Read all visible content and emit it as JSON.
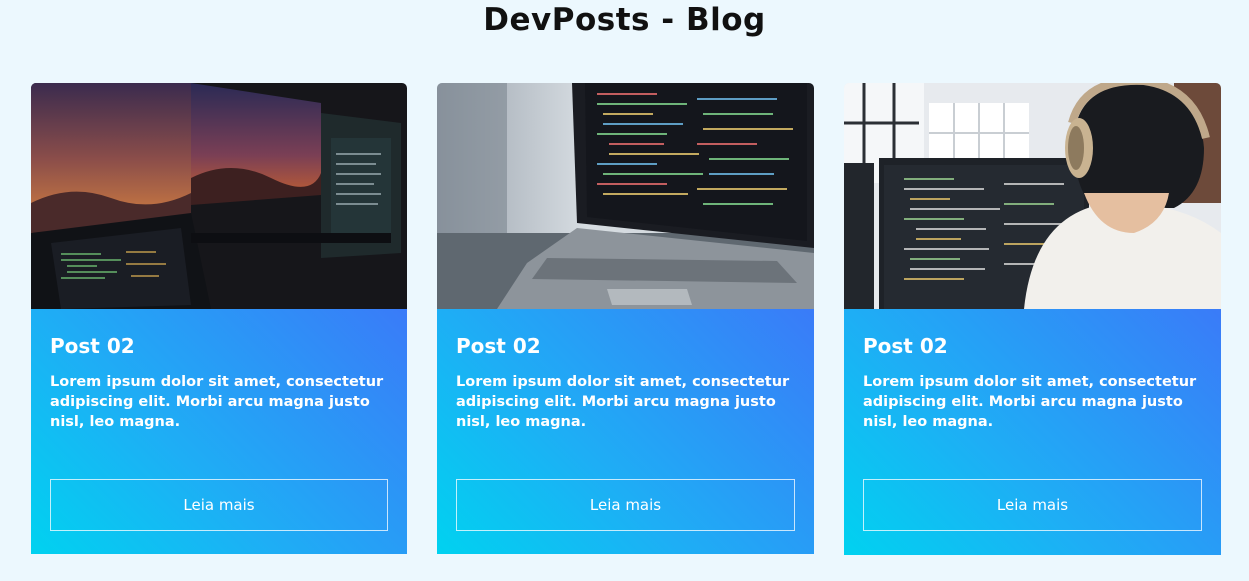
{
  "header": {
    "title": "DevPosts - Blog"
  },
  "posts": [
    {
      "title": "Post 02",
      "text": "Lorem ipsum dolor sit amet, consectetur adipiscing elit. Morbi arcu magna justo nisl, leo magna.",
      "button": "Leia mais"
    },
    {
      "title": "Post 02",
      "text": "Lorem ipsum dolor sit amet, consectetur adipiscing elit. Morbi arcu magna justo nisl, leo magna.",
      "button": "Leia mais"
    },
    {
      "title": "Post 02",
      "text": "Lorem ipsum dolor sit amet, consectetur adipiscing elit. Morbi arcu magna justo nisl, leo magna.",
      "button": "Leia mais"
    }
  ],
  "colors": {
    "background": "#ecf8fe",
    "gradient_start": "#00d2f0",
    "gradient_end": "#3a7bf8"
  }
}
